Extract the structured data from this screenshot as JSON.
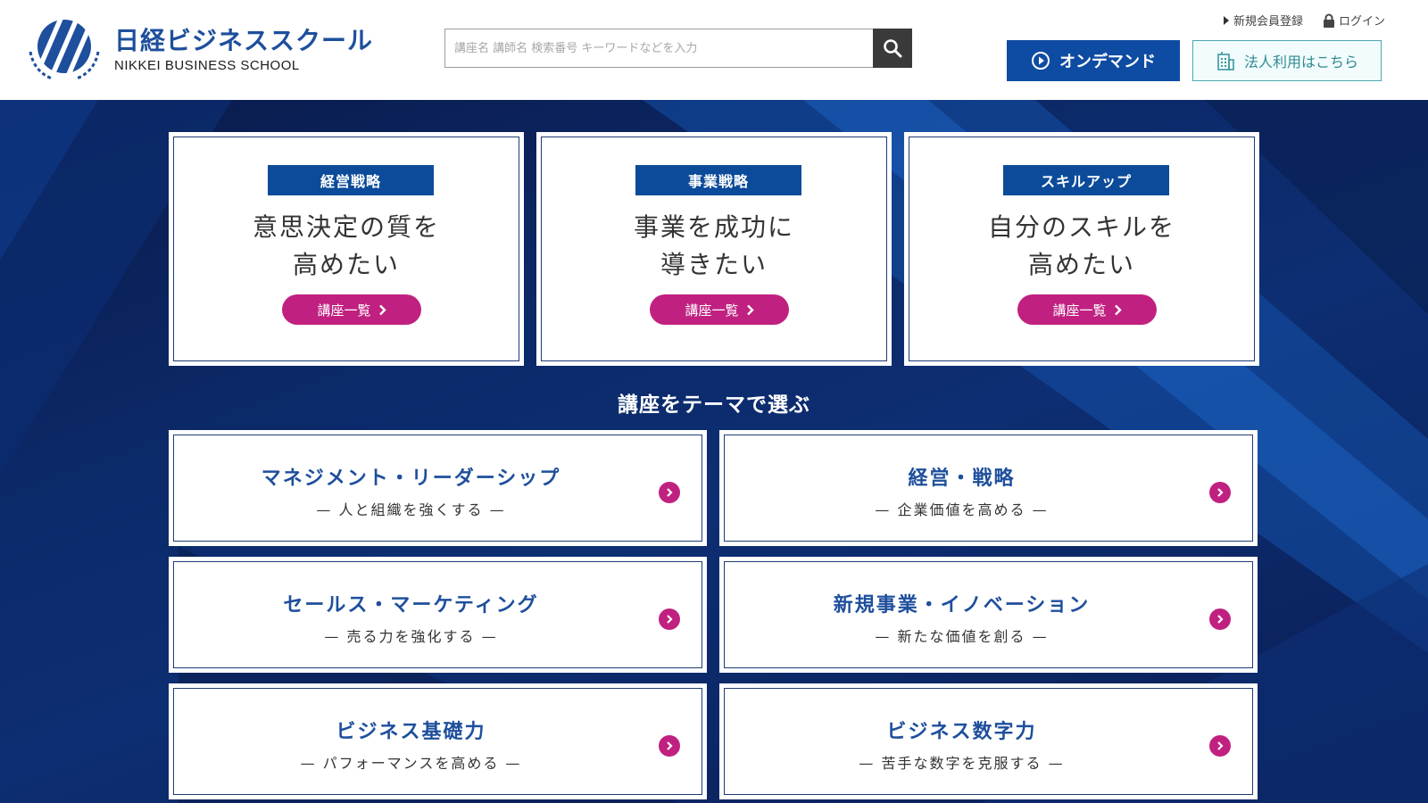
{
  "header": {
    "logo_ja": "日経ビジネススクール",
    "logo_en": "NIKKEI BUSINESS SCHOOL",
    "search_placeholder": "講座名 講師名 検索番号 キーワードなどを入力",
    "links": {
      "register": "新規会員登録",
      "login": "ログイン"
    },
    "ondemand_label": "オンデマンド",
    "corporate_label": "法人利用はこちら"
  },
  "categories": [
    {
      "tag": "経営戦略",
      "line1": "意思決定の質を",
      "line2": "高めたい",
      "button": "講座一覧"
    },
    {
      "tag": "事業戦略",
      "line1": "事業を成功に",
      "line2": "導きたい",
      "button": "講座一覧"
    },
    {
      "tag": "スキルアップ",
      "line1": "自分のスキルを",
      "line2": "高めたい",
      "button": "講座一覧"
    }
  ],
  "themes_title": "講座をテーマで選ぶ",
  "themes": [
    {
      "title": "マネジメント・リーダーシップ",
      "sub": "—  人と組織を強くする  —"
    },
    {
      "title": "経営・戦略",
      "sub": "—  企業価値を高める  —"
    },
    {
      "title": "セールス・マーケティング",
      "sub": "—  売る力を強化する  —"
    },
    {
      "title": "新規事業・イノベーション",
      "sub": "—  新たな価値を創る  —"
    },
    {
      "title": "ビジネス基礎力",
      "sub": "—  パフォーマンスを高める  —"
    },
    {
      "title": "ビジネス数字力",
      "sub": "—  苦手な数字を克服する  —"
    }
  ],
  "colors": {
    "brand_blue": "#0e4ba3",
    "accent_magenta": "#c02180",
    "corp_teal": "#2f8a92"
  }
}
